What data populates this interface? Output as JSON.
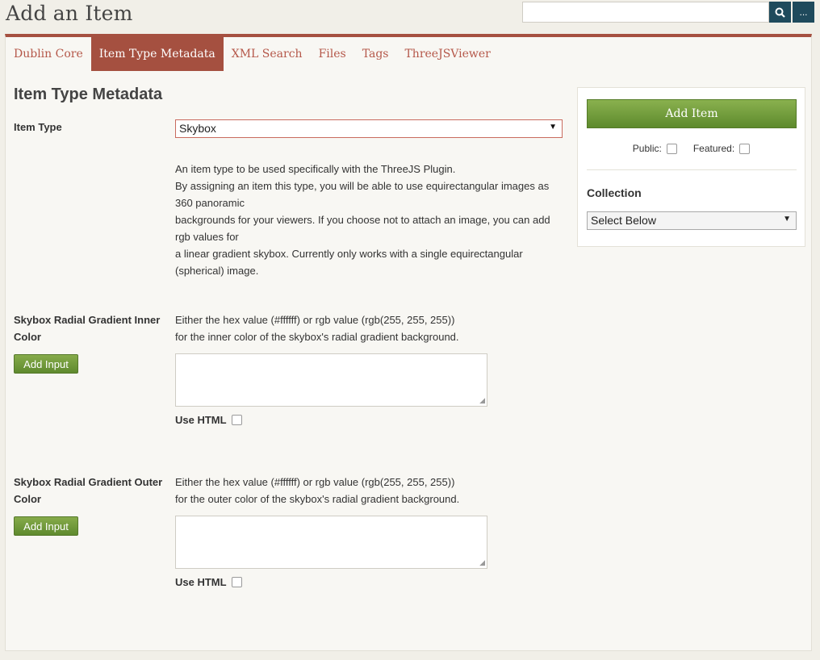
{
  "header": {
    "title": "Add an Item",
    "search": {
      "value": "",
      "search_icon": "search-icon",
      "advanced_label": "..."
    }
  },
  "tabs": [
    {
      "label": "Dublin Core",
      "active": false
    },
    {
      "label": "Item Type Metadata",
      "active": true
    },
    {
      "label": "XML Search",
      "active": false
    },
    {
      "label": "Files",
      "active": false
    },
    {
      "label": "Tags",
      "active": false
    },
    {
      "label": "ThreeJSViewer",
      "active": false
    }
  ],
  "main": {
    "section_title": "Item Type Metadata",
    "item_type": {
      "label": "Item Type",
      "selected": "Skybox",
      "description_lines": [
        "An item type to be used specifically with the ThreeJS Plugin.",
        "By assigning an item this type, you will be able to use equirectangular images as",
        "360 panoramic",
        "backgrounds for your viewers. If you choose not to attach an image, you can add",
        "rgb values for",
        "a linear gradient skybox. Currently only works with a single equirectangular",
        "(spherical) image."
      ]
    },
    "fields": [
      {
        "label_line1": "Skybox Radial Gradient Inner",
        "label_line2": "Color",
        "help_line1": "Either the hex value (#ffffff) or rgb value (rgb(255, 255, 255))",
        "help_line2": "for the inner color of the skybox's radial gradient background.",
        "add_input_label": "Add Input",
        "value": "",
        "use_html_label": "Use HTML",
        "use_html_checked": false
      },
      {
        "label_line1": "Skybox Radial Gradient Outer",
        "label_line2": "Color",
        "help_line1": "Either the hex value (#ffffff) or rgb value (rgb(255, 255, 255))",
        "help_line2": "for the outer color of the skybox's radial gradient background.",
        "add_input_label": "Add Input",
        "value": "",
        "use_html_label": "Use HTML",
        "use_html_checked": false
      }
    ]
  },
  "sidebar": {
    "add_item_label": "Add Item",
    "public_label": "Public:",
    "public_checked": false,
    "featured_label": "Featured:",
    "featured_checked": false,
    "collection_label": "Collection",
    "collection_selected": "Select Below"
  },
  "colors": {
    "accent": "#a55040",
    "tab_text": "#b5584a",
    "button_green": "#6f9a38",
    "search_button": "#1f4a5c",
    "background": "#f1efe8"
  }
}
